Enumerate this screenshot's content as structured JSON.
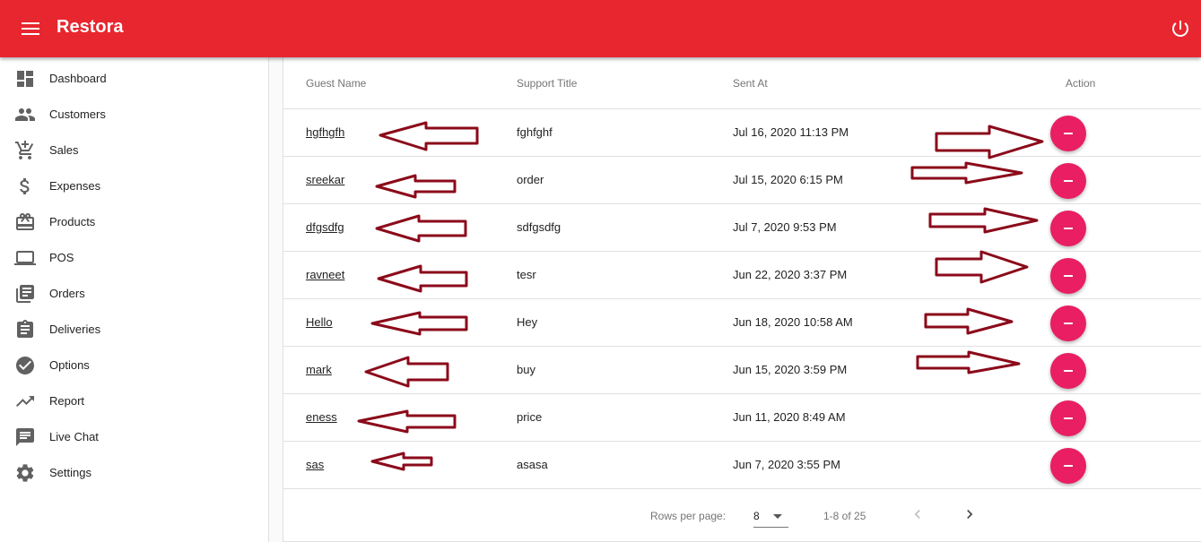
{
  "app": {
    "title": "Restora"
  },
  "sidebar": {
    "items": [
      {
        "label": "Dashboard",
        "icon": "dashboard-icon"
      },
      {
        "label": "Customers",
        "icon": "people-icon"
      },
      {
        "label": "Sales",
        "icon": "cart-add-icon"
      },
      {
        "label": "Expenses",
        "icon": "dollar-icon"
      },
      {
        "label": "Products",
        "icon": "gift-card-icon"
      },
      {
        "label": "POS",
        "icon": "laptop-icon"
      },
      {
        "label": "Orders",
        "icon": "library-books-icon"
      },
      {
        "label": "Deliveries",
        "icon": "clipboard-icon"
      },
      {
        "label": "Options",
        "icon": "check-circle-icon"
      },
      {
        "label": "Report",
        "icon": "trending-up-icon"
      },
      {
        "label": "Live Chat",
        "icon": "chat-icon"
      },
      {
        "label": "Settings",
        "icon": "gear-icon"
      }
    ]
  },
  "table": {
    "headers": {
      "guest": "Guest Name",
      "title": "Support Title",
      "sent": "Sent At",
      "action": "Action"
    },
    "rows": [
      {
        "guest": "hgfhgfh",
        "title": "fghfghf",
        "sent": "Jul 16, 2020 11:13 PM"
      },
      {
        "guest": "sreekar",
        "title": "order",
        "sent": "Jul 15, 2020 6:15 PM"
      },
      {
        "guest": "dfgsdfg",
        "title": "sdfgsdfg",
        "sent": "Jul 7, 2020 9:53 PM"
      },
      {
        "guest": "ravneet",
        "title": "tesr",
        "sent": "Jun 22, 2020 3:37 PM"
      },
      {
        "guest": "Hello",
        "title": "Hey",
        "sent": "Jun 18, 2020 10:58 AM"
      },
      {
        "guest": "mark",
        "title": "buy",
        "sent": "Jun 15, 2020 3:59 PM"
      },
      {
        "guest": "eness",
        "title": "price",
        "sent": "Jun 11, 2020 8:49 AM"
      },
      {
        "guest": "sas",
        "title": "asasa",
        "sent": "Jun 7, 2020 3:55 PM"
      }
    ]
  },
  "pagination": {
    "rows_per_page_label": "Rows per page:",
    "rows_per_page": "8",
    "range": "1-8 of 25"
  },
  "colors": {
    "appbar": "#e8262f",
    "delete_button": "#e91e63",
    "annotation_arrow": "#8b0a1a"
  }
}
